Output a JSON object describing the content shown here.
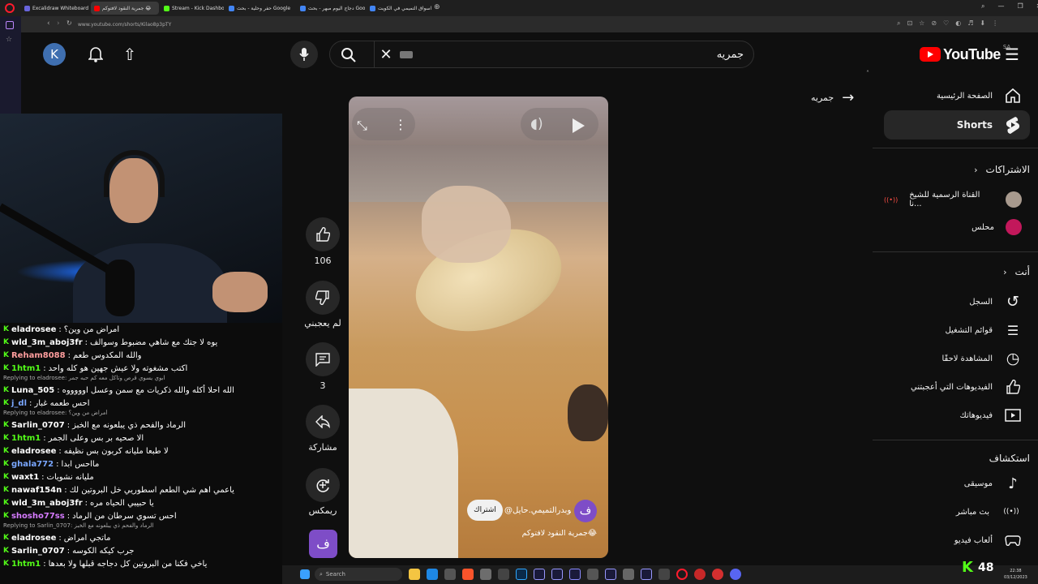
{
  "browser": {
    "tabs": [
      {
        "label": "Excalidraw Whiteboard",
        "color": "#6965db"
      },
      {
        "label": "جمرية النقود لافتوكم 😂",
        "color": "#ff0000"
      },
      {
        "label": "Stream - Kick Dashboard",
        "color": "#53fc18"
      },
      {
        "label": "حفر وحلية - بحث Google",
        "color": "#4285f4"
      },
      {
        "label": "دجاج اليوم مبهر - بحث Google",
        "color": "#4285f4"
      },
      {
        "label": "اسواق التميمي في الكويت",
        "color": "#4285f4"
      }
    ],
    "url": "www.youtube.com/shorts/Kilao8p3pTY"
  },
  "header": {
    "avatar_letter": "K",
    "search_value": "جمريه",
    "logo_text": "YouTube",
    "region": "SA"
  },
  "sidebar": {
    "items_top": [
      {
        "label": "الصفحة الرئيسية",
        "icon": "home-icon",
        "glyph": "⌂"
      },
      {
        "label": "Shorts",
        "icon": "shorts-icon",
        "glyph": "⚡"
      }
    ],
    "subscriptions_title": "الاشتراكات",
    "subscriptions": [
      {
        "label": "القناة الرسمية للشيخ نا...",
        "icon": "channel-avatar-icon",
        "live": "((•))"
      },
      {
        "label": "محلس",
        "icon": "channel-avatar-icon",
        "live": ""
      }
    ],
    "you_title": "أنت",
    "you_items": [
      {
        "label": "السجل",
        "icon": "history-icon",
        "glyph": "↺"
      },
      {
        "label": "قوائم التشغيل",
        "icon": "playlist-icon",
        "glyph": "☰"
      },
      {
        "label": "المشاهدة لاحقًا",
        "icon": "clock-icon",
        "glyph": "◷"
      },
      {
        "label": "الفيديوهات التي أعجبتني",
        "icon": "like-icon",
        "glyph": "👍"
      },
      {
        "label": "فيديوهاتك",
        "icon": "video-icon",
        "glyph": "▶"
      }
    ],
    "explore_title": "استكشاف",
    "explore_items": [
      {
        "label": "موسيقى",
        "icon": "music-icon",
        "glyph": "♪"
      },
      {
        "label": "بث مباشر",
        "icon": "live-icon",
        "glyph": "((•))"
      },
      {
        "label": "ألعاب فيديو",
        "icon": "gamepad-icon",
        "glyph": "🎮"
      }
    ]
  },
  "back_search": "جمريه",
  "video": {
    "channel_handle": "@ابوبدرالتميمي.حايل",
    "subscribe_label": "اشتراك",
    "title": "جمرية النقود لافتوكم😂",
    "channel_letter": "ف"
  },
  "actions": {
    "likes": "106",
    "dislike_label": "لم يعجبني",
    "comments": "3",
    "share_label": "مشاركة",
    "remix_label": "ريمكس",
    "channel_letter": "ف"
  },
  "chat": {
    "messages": [
      {
        "type": "msg",
        "user": "eladrosee",
        "user_color": "#ffffff",
        "text": "امراض من وين؟"
      },
      {
        "type": "msg",
        "user": "wld_3m_aboj3fr",
        "user_color": "#ffffff",
        "text": "يوه لا جتك مع شاهي مضبوط وسوالف"
      },
      {
        "type": "msg",
        "user": "Reham8088",
        "user_color": "#ff9e9e",
        "text": "والله المكدوس طعم"
      },
      {
        "type": "msg",
        "user": "1htm1",
        "user_color": "#53fc18",
        "text": "اكتب مشغوته ولا عيش جهين هو كله واحد"
      },
      {
        "type": "reply",
        "text": "Replying to eladrosee: ابوي يسوي قرص وتاكل معه كم حبه جمر"
      },
      {
        "type": "msg",
        "user": "Luna_505",
        "user_color": "#ffffff",
        "text": "الله احلا أكله والله ذكريات مع سمن وعسل اوووووه"
      },
      {
        "type": "msg",
        "user": "j_dl",
        "user_color": "#7aa7ff",
        "text": "احس طعمه غبار"
      },
      {
        "type": "reply",
        "text": "Replying to eladrosee: أمراض من وين؟"
      },
      {
        "type": "msg",
        "user": "Sarlin_0707",
        "user_color": "#ffffff",
        "text": "الرماد والفحم ذي يبلعونه مع الخبز"
      },
      {
        "type": "msg",
        "user": "1htm1",
        "user_color": "#53fc18",
        "text": "الا صحيه بر بس وعلى الجمر"
      },
      {
        "type": "msg",
        "user": "eladrosee",
        "user_color": "#ffffff",
        "text": "لا طبعا مليانه كربون بس نظيفه"
      },
      {
        "type": "msg",
        "user": "ghala772",
        "user_color": "#7aa7ff",
        "text": "مااحس ابدا"
      },
      {
        "type": "msg",
        "user": "waxt1",
        "user_color": "#ffffff",
        "text": "مليانه نشويات"
      },
      {
        "type": "msg",
        "user": "nawaf154n",
        "user_color": "#ffffff",
        "text": "ياعمي اهم شي الطعم اسطوريي خل البروتين لك"
      },
      {
        "type": "msg",
        "user": "wld_3m_aboj3fr",
        "user_color": "#ffffff",
        "text": "يا حبيبي الحياه مره"
      },
      {
        "type": "msg",
        "user": "shosho77ss",
        "user_color": "#d67bff",
        "text": "احس تسوي سرطان من الرماد"
      },
      {
        "type": "reply",
        "text": "Replying to Sarlin_0707: الرماد والفحم ذي يبلعونه مع الخبز"
      },
      {
        "type": "msg",
        "user": "eladrosee",
        "user_color": "#ffffff",
        "text": "ماتجي امراض"
      },
      {
        "type": "msg",
        "user": "Sarlin_0707",
        "user_color": "#ffffff",
        "text": "جرب كيكه الكوسه"
      },
      {
        "type": "msg",
        "user": "1htm1",
        "user_color": "#53fc18",
        "text": "ياخي فكنا من البروتين كل دجاجه قبلها ولا بعدها"
      }
    ]
  },
  "taskbar": {
    "search_placeholder": "Search",
    "viewers": "48",
    "time": "22:38",
    "date": "03/12/2023"
  }
}
